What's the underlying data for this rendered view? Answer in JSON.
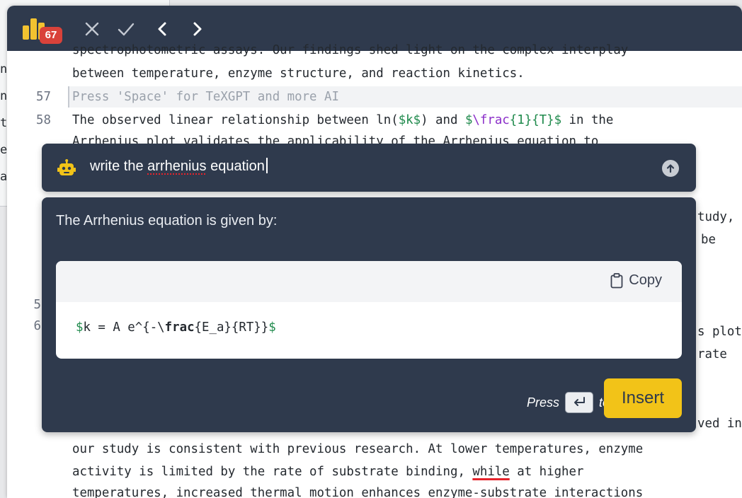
{
  "background_window": {
    "fragments": [
      "n",
      "n",
      "t",
      "e",
      "a"
    ]
  },
  "toolbar": {
    "badge_count": "67",
    "close_icon": "close-icon",
    "accept_icon": "check-icon",
    "prev_icon": "chevron-left-icon",
    "next_icon": "chevron-right-icon"
  },
  "editor": {
    "partial_top_line": "spectrophotometric assays. Our findings shed light on the complex interplay",
    "line_56_text": "between temperature, enzyme structure, and reaction kinetics.",
    "line_57_number": "57",
    "line_57_placeholder": "Press 'Space' for TeXGPT and more AI",
    "line_58_number": "58",
    "line_58_a": "The observed linear relationship between ln(",
    "line_58_math1": "$k$",
    "line_58_b": ") and ",
    "line_58_math2_open": "$",
    "line_58_math2_cmd": "\\frac",
    "line_58_math2_rest": "{1}{T}$",
    "line_58_c": " in the",
    "line_59_partial": "Arrhenius plot validates the applicability of the Arrhenius equation to",
    "hidden_gutter_1": "5",
    "hidden_gutter_2": "6",
    "right_fragments": [
      "tudy,",
      "be",
      "s plot",
      "rate",
      "ved in"
    ],
    "bottom_line_1": "our study is consistent with previous research. At lower temperatures, enzyme",
    "bottom_line_2a": "activity is limited by the rate of substrate binding, ",
    "bottom_line_2_word": "while",
    "bottom_line_2b": " at higher",
    "bottom_line_3": "temperatures, increased thermal motion enhances enzyme-substrate interactions"
  },
  "prompt": {
    "text_before": "write the ",
    "text_misspelled": "arrhenius",
    "text_after": " equation",
    "bot_icon": "robot-icon",
    "send_icon": "send-up-arrow-icon"
  },
  "response": {
    "intro": "The Arrhenius equation is given by:",
    "copy_label": "Copy",
    "copy_icon": "clipboard-icon",
    "code_open": "$",
    "code_a": "k = A e^{-\\",
    "code_bold": "frac",
    "code_b": "{E_a}{RT}}",
    "code_close": "$",
    "press_label": "Press",
    "to_label": "to",
    "enter_icon": "enter-key-icon",
    "insert_label": "Insert"
  },
  "colors": {
    "toolbar_bg": "#2f3a4d",
    "accent_yellow": "#f2c318",
    "badge_red": "#d9423a",
    "math_green": "#1f8a4c",
    "command_purple": "#8b2fc9"
  }
}
